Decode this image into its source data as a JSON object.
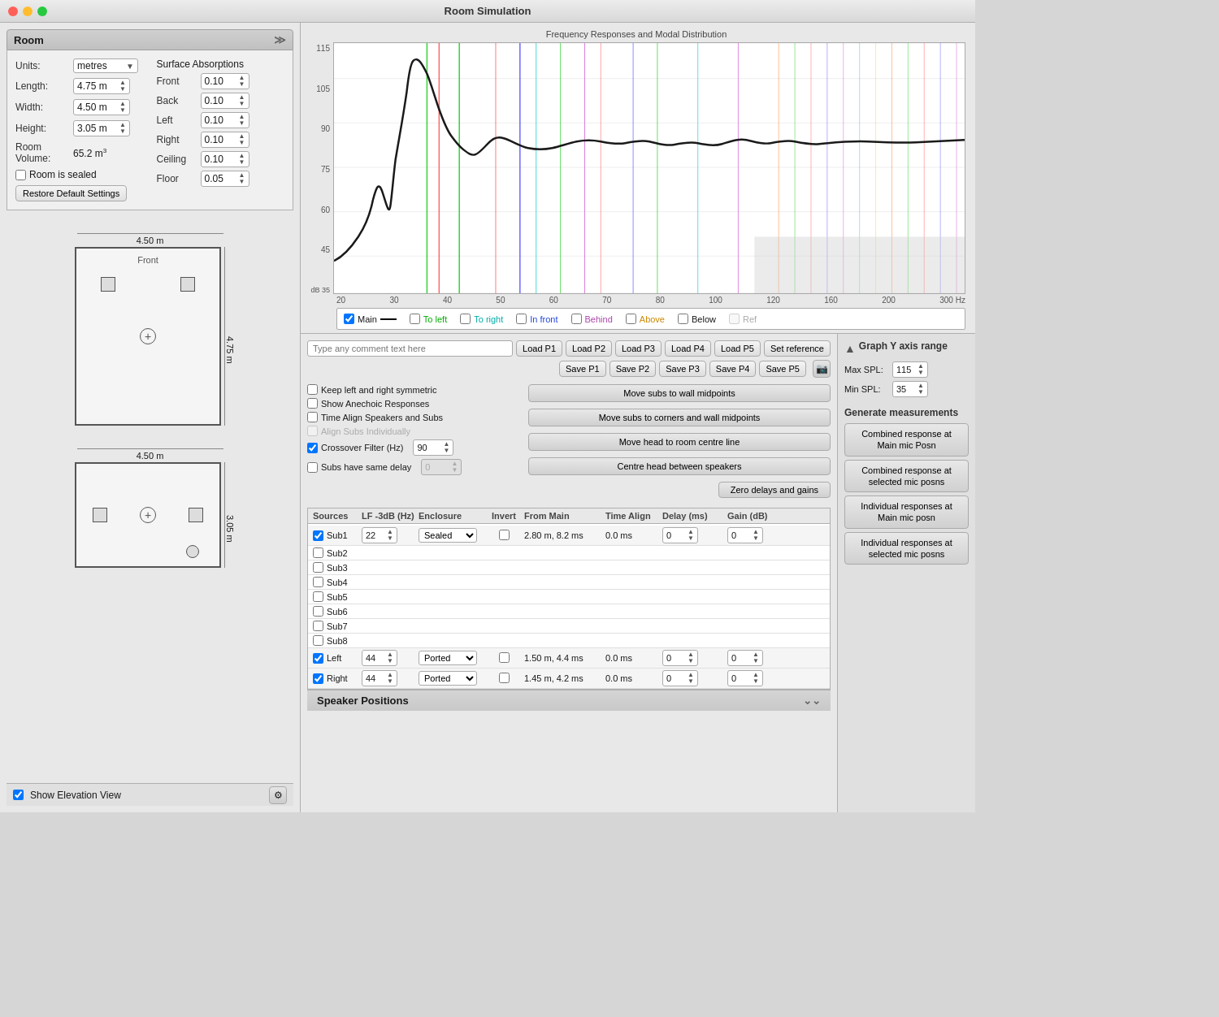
{
  "window": {
    "title": "Room Simulation"
  },
  "room_panel": {
    "title": "Room",
    "units_label": "Units:",
    "units_value": "metres",
    "length_label": "Length:",
    "length_value": "4.75 m",
    "width_label": "Width:",
    "width_value": "4.50 m",
    "height_label": "Height:",
    "height_value": "3.05 m",
    "volume_label": "Room Volume:",
    "volume_value": "65.2 m³",
    "sealed_label": "Room is sealed",
    "restore_btn": "Restore Default Settings"
  },
  "surface_absorptions": {
    "title": "Surface Absorptions",
    "surfaces": [
      {
        "name": "Front",
        "value": "0.10"
      },
      {
        "name": "Back",
        "value": "0.10"
      },
      {
        "name": "Left",
        "value": "0.10"
      },
      {
        "name": "Right",
        "value": "0.10"
      },
      {
        "name": "Ceiling",
        "value": "0.10"
      },
      {
        "name": "Floor",
        "value": "0.05"
      }
    ]
  },
  "diagram": {
    "top_width": "4.50 m",
    "top_height": "4.75 m",
    "top_front_label": "Front",
    "side_width": "4.50 m",
    "side_height": "3.05 m"
  },
  "graph": {
    "title": "Frequency Responses and Modal Distribution",
    "y_max": 115,
    "y_min": 35,
    "x_labels": [
      "20",
      "30",
      "40",
      "50",
      "60",
      "70",
      "80",
      "100",
      "120",
      "160",
      "200",
      "300 Hz"
    ],
    "y_labels": [
      "115",
      "105",
      "90",
      "75",
      "60",
      "45",
      "dB 35"
    ],
    "db_label": "dB"
  },
  "legend": {
    "items": [
      {
        "id": "main",
        "label": "Main",
        "checked": true,
        "color": "#000000",
        "show_line": true
      },
      {
        "id": "to_left",
        "label": "To left",
        "checked": false,
        "color": "#00aa00"
      },
      {
        "id": "to_right",
        "label": "To right",
        "checked": false,
        "color": "#00aaaa"
      },
      {
        "id": "in_front",
        "label": "In front",
        "checked": false,
        "color": "#0000ff"
      },
      {
        "id": "behind",
        "label": "Behind",
        "checked": false,
        "color": "#aa00aa"
      },
      {
        "id": "above",
        "label": "Above",
        "checked": false,
        "color": "#cc8800"
      },
      {
        "id": "below",
        "label": "Below",
        "checked": false,
        "color": "#888888"
      },
      {
        "id": "ref",
        "label": "Ref",
        "checked": false,
        "color": "#888888",
        "disabled": true
      }
    ]
  },
  "controls": {
    "comment_placeholder": "Type any comment text here",
    "load_btns": [
      "Load P1",
      "Load P2",
      "Load P3",
      "Load P4",
      "Load P5"
    ],
    "save_btns": [
      "Save P1",
      "Save P2",
      "Save P3",
      "Save P4",
      "Save P5"
    ],
    "set_reference": "Set reference",
    "options": [
      {
        "id": "keep_symmetric",
        "label": "Keep left and right symmetric",
        "checked": false
      },
      {
        "id": "show_anechoic",
        "label": "Show Anechoic Responses",
        "checked": false
      },
      {
        "id": "time_align",
        "label": "Time Align Speakers and Subs",
        "checked": false
      },
      {
        "id": "align_subs",
        "label": "Align Subs Individually",
        "checked": false,
        "disabled": true
      }
    ],
    "crossover_label": "Crossover Filter (Hz)",
    "crossover_checked": true,
    "crossover_value": "90",
    "subs_delay_label": "Subs have same delay",
    "subs_delay_checked": false,
    "subs_delay_value": "0",
    "action_btns": [
      "Move subs to wall midpoints",
      "Move subs to corners and wall midpoints",
      "Move head to room centre line",
      "Centre head between speakers"
    ],
    "zero_delays_btn": "Zero delays and gains"
  },
  "table": {
    "headers": {
      "sources": "Sources",
      "lf": "LF -3dB (Hz)",
      "enclosure": "Enclosure",
      "invert": "Invert",
      "from_main": "From Main",
      "time_align": "Time Align",
      "delay": "Delay (ms)",
      "gain": "Gain (dB)"
    },
    "rows": [
      {
        "name": "Sub1",
        "checked": true,
        "lf": "22",
        "enclosure": "Sealed",
        "invert": false,
        "from_main": "2.80 m, 8.2 ms",
        "time_align": "0.0 ms",
        "delay": "0",
        "gain": "0"
      },
      {
        "name": "Sub2",
        "checked": false,
        "lf": "",
        "enclosure": "",
        "invert": false,
        "from_main": "",
        "time_align": "",
        "delay": "",
        "gain": ""
      },
      {
        "name": "Sub3",
        "checked": false,
        "lf": "",
        "enclosure": "",
        "invert": false,
        "from_main": "",
        "time_align": "",
        "delay": "",
        "gain": ""
      },
      {
        "name": "Sub4",
        "checked": false,
        "lf": "",
        "enclosure": "",
        "invert": false,
        "from_main": "",
        "time_align": "",
        "delay": "",
        "gain": ""
      },
      {
        "name": "Sub5",
        "checked": false,
        "lf": "",
        "enclosure": "",
        "invert": false,
        "from_main": "",
        "time_align": "",
        "delay": "",
        "gain": ""
      },
      {
        "name": "Sub6",
        "checked": false,
        "lf": "",
        "enclosure": "",
        "invert": false,
        "from_main": "",
        "time_align": "",
        "delay": "",
        "gain": ""
      },
      {
        "name": "Sub7",
        "checked": false,
        "lf": "",
        "enclosure": "",
        "invert": false,
        "from_main": "",
        "time_align": "",
        "delay": "",
        "gain": ""
      },
      {
        "name": "Sub8",
        "checked": false,
        "lf": "",
        "enclosure": "",
        "invert": false,
        "from_main": "",
        "time_align": "",
        "delay": "",
        "gain": ""
      },
      {
        "name": "Left",
        "checked": true,
        "lf": "44",
        "enclosure": "Ported",
        "invert": false,
        "from_main": "1.50 m, 4.4 ms",
        "time_align": "0.0 ms",
        "delay": "0",
        "gain": "0"
      },
      {
        "name": "Right",
        "checked": true,
        "lf": "44",
        "enclosure": "Ported",
        "invert": false,
        "from_main": "1.45 m, 4.2 ms",
        "time_align": "0.0 ms",
        "delay": "0",
        "gain": "0"
      }
    ]
  },
  "right_sidebar": {
    "y_axis_title": "Graph Y axis range",
    "max_spl_label": "Max SPL:",
    "max_spl_value": "115",
    "min_spl_label": "Min SPL:",
    "min_spl_value": "35",
    "gen_title": "Generate measurements",
    "gen_btns": [
      "Combined response at\nMain mic Posn",
      "Combined response at\nselected mic posns",
      "Individual responses at\nMain mic posn",
      "Individual responses at\nselected mic posns"
    ]
  },
  "bottom": {
    "show_elevation": "Show Elevation View",
    "speaker_positions": "Speaker Positions"
  }
}
